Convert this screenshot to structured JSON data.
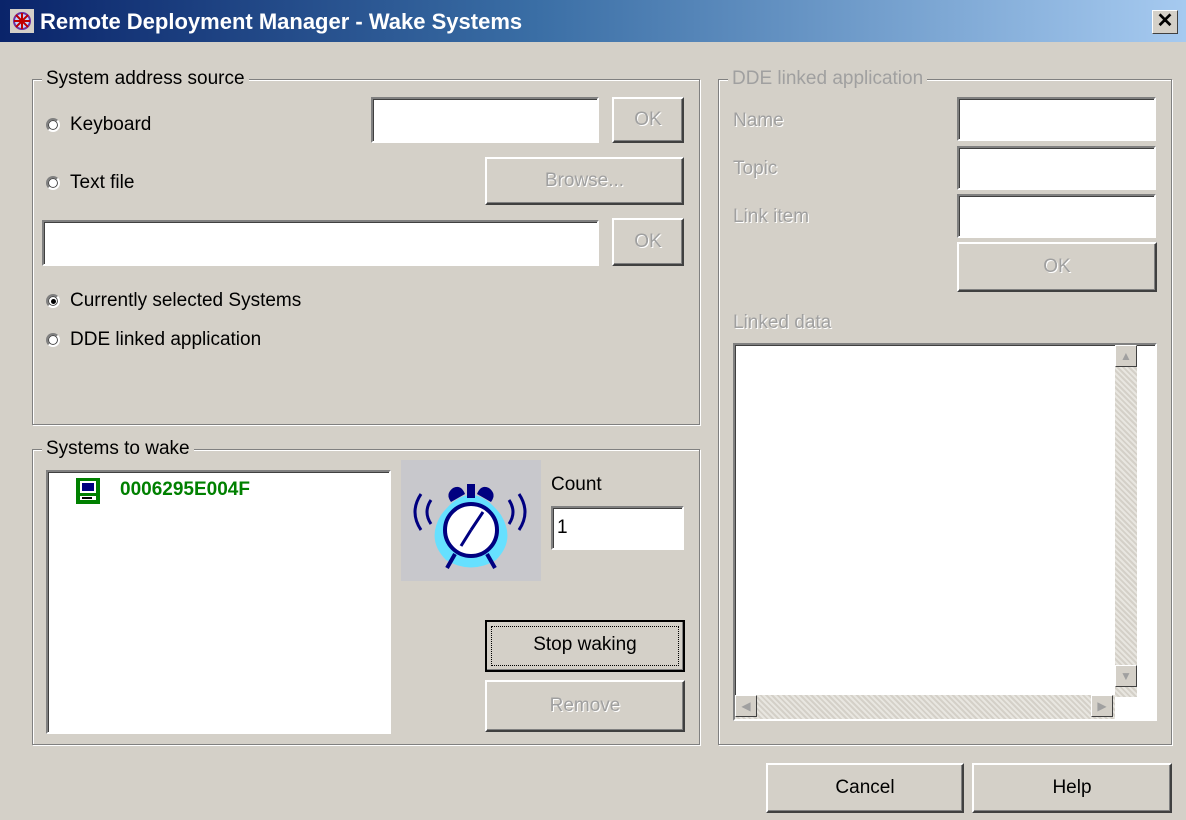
{
  "window": {
    "title": "Remote Deployment Manager - Wake Systems",
    "close_glyph": "✕"
  },
  "address_source": {
    "legend": "System address source",
    "keyboard": {
      "label": "Keyboard",
      "value": "",
      "ok": "OK"
    },
    "text_file": {
      "label": "Text file",
      "browse": "Browse...",
      "path_value": "",
      "ok": "OK"
    },
    "currently_selected": {
      "label": "Currently selected Systems",
      "checked": true
    },
    "dde_linked": {
      "label": "DDE linked application",
      "checked": false
    }
  },
  "systems_to_wake": {
    "legend": "Systems to wake",
    "items": [
      {
        "name": "0006295E004F",
        "icon": "computer-icon",
        "color": "#008000"
      }
    ],
    "count_label": "Count",
    "count_value": "1",
    "stop_waking": "Stop waking",
    "remove": "Remove"
  },
  "dde": {
    "legend": "DDE linked application",
    "name_label": "Name",
    "topic_label": "Topic",
    "link_item_label": "Link item",
    "name_value": "",
    "topic_value": "",
    "link_item_value": "",
    "ok": "OK",
    "linked_data_label": "Linked data"
  },
  "footer": {
    "cancel": "Cancel",
    "help": "Help"
  }
}
